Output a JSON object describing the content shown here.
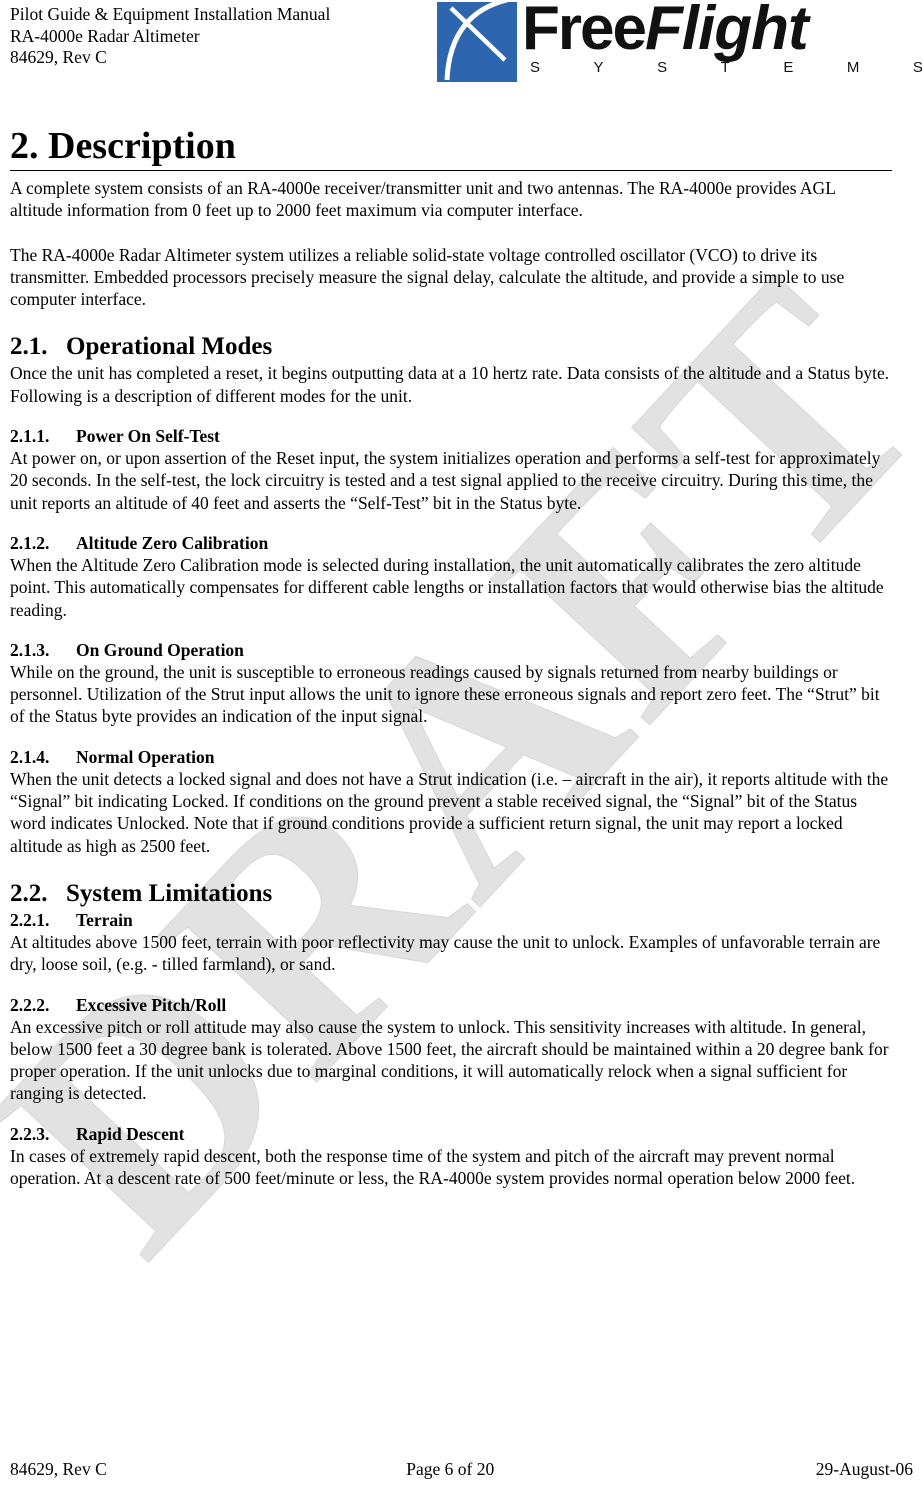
{
  "header": {
    "line1": "Pilot Guide & Equipment Installation Manual",
    "line2": "RA-4000e Radar Altimeter",
    "line3": "84629, Rev C",
    "logo": {
      "word1": "Free",
      "word2": "Flight",
      "tagline_letters": [
        "S",
        "Y",
        "S",
        "T",
        "E",
        "M",
        "S"
      ],
      "mark_color": "#2d66ae",
      "text_color": "#111111"
    }
  },
  "watermark": {
    "text": "DRAFT",
    "color": "#e2e2e2"
  },
  "sections": {
    "s2": {
      "heading": "2. Description",
      "p1": "A complete system consists of an RA-4000e receiver/transmitter unit and two antennas.  The RA-4000e provides AGL altitude information from 0 feet up to 2000 feet maximum via computer interface.",
      "p2": "The RA-4000e Radar Altimeter system utilizes a reliable solid-state voltage controlled oscillator (VCO) to drive its transmitter.  Embedded processors precisely measure the signal delay, calculate the altitude, and provide a simple to use computer interface."
    },
    "s21": {
      "number": "2.1.",
      "title": "Operational Modes",
      "p1": "Once the unit has completed a reset, it begins outputting data at a 10 hertz rate.  Data consists of the altitude and a Status byte.  Following is a description of different modes for the unit."
    },
    "s211": {
      "number": "2.1.1.",
      "title": "Power On Self-Test",
      "p1": "At power on, or upon assertion of the Reset input, the system initializes operation and performs a self-test for approximately 20 seconds.  In the self-test, the lock circuitry is tested and a test signal applied to the receive circuitry.  During this time, the unit reports an altitude of 40 feet and asserts the “Self-Test” bit in the Status byte."
    },
    "s212": {
      "number": "2.1.2.",
      "title": "Altitude Zero Calibration",
      "p1": "When the Altitude Zero Calibration mode is selected during installation, the unit automatically calibrates the zero altitude point.  This automatically compensates for different cable lengths or installation factors that would otherwise bias the altitude reading."
    },
    "s213": {
      "number": "2.1.3.",
      "title": "On Ground Operation",
      "p1": "While on the ground, the unit is susceptible to erroneous readings caused by signals returned from nearby buildings or personnel.  Utilization of the Strut input allows the unit to ignore these erroneous signals and report zero feet.  The “Strut” bit of the Status byte provides an indication of the input signal."
    },
    "s214": {
      "number": "2.1.4.",
      "title": "Normal Operation",
      "p1": "When the unit detects a locked signal and does not have a Strut indication (i.e. – aircraft in the air), it reports altitude with the “Signal” bit indicating Locked.  If conditions on the ground prevent a stable received signal, the “Signal” bit of the Status word indicates Unlocked.   Note that if ground conditions provide a sufficient return signal, the unit may report a locked altitude as high as 2500 feet."
    },
    "s22": {
      "number": "2.2.",
      "title": "System Limitations"
    },
    "s221": {
      "number": "2.2.1.",
      "title": "Terrain",
      "p1": "At altitudes above 1500 feet, terrain with poor reflectivity may cause the unit to unlock.  Examples of unfavorable terrain are dry, loose soil, (e.g. - tilled farmland), or sand."
    },
    "s222": {
      "number": "2.2.2.",
      "title": "Excessive Pitch/Roll",
      "p1": "An excessive pitch or roll attitude may also cause the system to unlock. This sensitivity increases with altitude.  In general, below 1500 feet a 30 degree bank is tolerated.  Above 1500 feet, the aircraft should be maintained within a 20 degree bank for proper operation.  If the unit unlocks due to marginal conditions, it will automatically relock when a signal sufficient for ranging is detected."
    },
    "s223": {
      "number": "2.2.3.",
      "title": "Rapid Descent",
      "p1": "In cases of extremely rapid descent, both the response time of the system and pitch of the aircraft may prevent normal operation. At a descent rate of 500 feet/minute or less, the RA-4000e system provides normal operation below 2000 feet."
    }
  },
  "footer": {
    "left": "84629, Rev C",
    "center": "Page 6 of 20",
    "right": "29-August-06"
  }
}
